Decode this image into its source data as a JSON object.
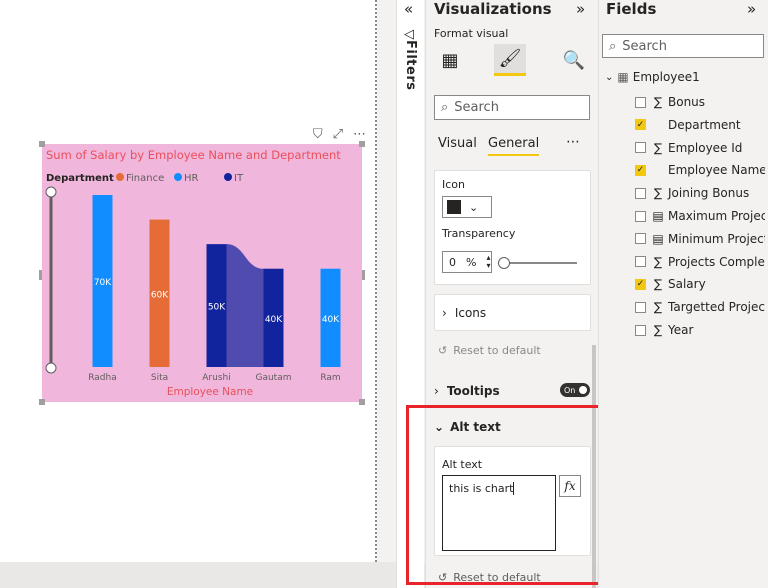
{
  "colors": {
    "accent": "#f2c811",
    "highlight": "#e8232a",
    "chart_bg": "#f1b6dc",
    "title": "#e8505b"
  },
  "filters": {
    "label": "Filters"
  },
  "visualizations": {
    "title": "Visualizations",
    "subtitle": "Format visual",
    "search_placeholder": "Search",
    "tabs": [
      "Visual",
      "General"
    ],
    "icon_card": {
      "icon_label": "Icon",
      "transparency_label": "Transparency",
      "transparency_value": "0",
      "transparency_unit": "%"
    },
    "icons_section": "Icons",
    "reset_label": "Reset to default",
    "tooltips_label": "Tooltips",
    "tooltips_toggle": "On",
    "alt_text_section": "Alt text",
    "alt_text_label": "Alt text",
    "alt_text_value": "this is chart ",
    "fx_label": "fx"
  },
  "fields": {
    "title": "Fields",
    "search_placeholder": "Search",
    "table_name": "Employee1",
    "items": [
      {
        "label": "Bonus",
        "sigma": true,
        "checked": false
      },
      {
        "label": "Department",
        "sigma": false,
        "checked": true
      },
      {
        "label": "Employee Id",
        "sigma": true,
        "checked": false
      },
      {
        "label": "Employee Name",
        "sigma": false,
        "checked": true
      },
      {
        "label": "Joining Bonus",
        "sigma": true,
        "checked": false
      },
      {
        "label": "Maximum Projects",
        "sigma": false,
        "calc": true,
        "checked": false
      },
      {
        "label": "Minimum Projects",
        "sigma": false,
        "calc": true,
        "checked": false
      },
      {
        "label": "Projects Complet...",
        "sigma": true,
        "checked": false
      },
      {
        "label": "Salary",
        "sigma": true,
        "checked": true
      },
      {
        "label": "Targetted Projects",
        "sigma": true,
        "checked": false
      },
      {
        "label": "Year",
        "sigma": true,
        "checked": false
      }
    ]
  },
  "chart_data": {
    "type": "bar",
    "title": "Sum of Salary by Employee Name and Department",
    "xlabel": "Employee Name",
    "ylabel": "",
    "legend_title": "Department",
    "legend_position": "top-left",
    "series": [
      {
        "name": "Finance",
        "color": "#e66c37"
      },
      {
        "name": "HR",
        "color": "#118dff"
      },
      {
        "name": "IT",
        "color": "#12239e"
      }
    ],
    "categories": [
      "Radha",
      "Sita",
      "Arushi",
      "Gautam",
      "Ram"
    ],
    "bars": [
      {
        "category": "Radha",
        "series": "HR",
        "value": 70000,
        "label": "70K"
      },
      {
        "category": "Sita",
        "series": "Finance",
        "value": 60000,
        "label": "60K"
      },
      {
        "category": "Arushi",
        "series": "IT",
        "value": 50000,
        "label": "50K"
      },
      {
        "category": "Gautam",
        "series": "IT",
        "value": 40000,
        "label": "40K"
      },
      {
        "category": "Ram",
        "series": "HR",
        "value": 40000,
        "label": "40K"
      }
    ],
    "ylim": [
      0,
      70000
    ],
    "grid": false
  }
}
